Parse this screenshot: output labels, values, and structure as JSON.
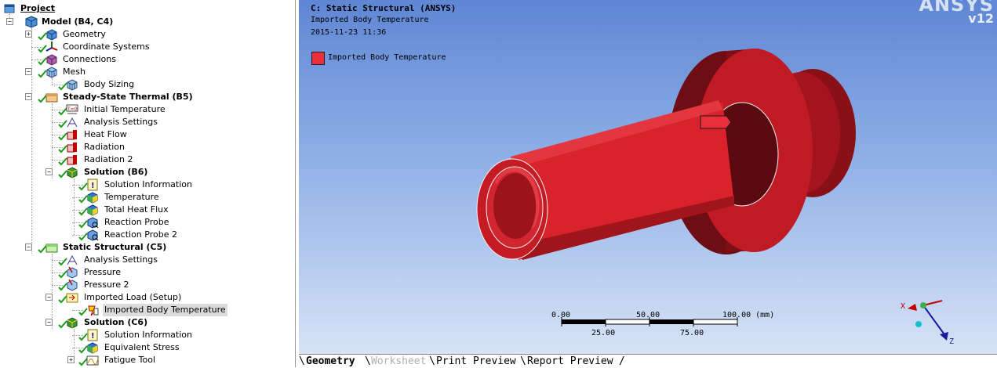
{
  "tree": {
    "root_label": "Project",
    "items": [
      {
        "label": "Model (B4, C4)",
        "bold": true
      },
      {
        "label": "Geometry"
      },
      {
        "label": "Coordinate Systems"
      },
      {
        "label": "Connections"
      },
      {
        "label": "Mesh"
      },
      {
        "label": "Body Sizing"
      },
      {
        "label": "Steady-State Thermal (B5)",
        "bold": true
      },
      {
        "label": "Initial Temperature"
      },
      {
        "label": "Analysis Settings"
      },
      {
        "label": "Heat Flow"
      },
      {
        "label": "Radiation"
      },
      {
        "label": "Radiation 2"
      },
      {
        "label": "Solution (B6)",
        "bold": true
      },
      {
        "label": "Solution Information"
      },
      {
        "label": "Temperature"
      },
      {
        "label": "Total Heat Flux"
      },
      {
        "label": "Reaction Probe"
      },
      {
        "label": "Reaction Probe 2"
      },
      {
        "label": "Static Structural (C5)",
        "bold": true
      },
      {
        "label": "Analysis Settings"
      },
      {
        "label": "Pressure"
      },
      {
        "label": "Pressure 2"
      },
      {
        "label": "Imported Load (Setup)"
      },
      {
        "label": "Imported Body Temperature",
        "selected": true
      },
      {
        "label": "Solution (C6)",
        "bold": true
      },
      {
        "label": "Solution Information"
      },
      {
        "label": "Equivalent Stress"
      },
      {
        "label": "Fatigue Tool"
      }
    ]
  },
  "viewport": {
    "title": "C: Static Structural (ANSYS)",
    "subtitle": "Imported Body Temperature",
    "date": "2015-11-23 11:36",
    "legend_label": "Imported Body Temperature",
    "legend_color": "#ea2f3a",
    "brand": "ANSYS",
    "version": "v12",
    "scale": {
      "top": [
        "0.00",
        "50.00",
        "100.00 (mm)"
      ],
      "bottom": [
        "25.00",
        "75.00"
      ]
    },
    "axes": {
      "x": "X",
      "z": "Z"
    }
  },
  "tabs": [
    "Geometry",
    "Worksheet",
    "Print Preview",
    "Report Preview"
  ]
}
